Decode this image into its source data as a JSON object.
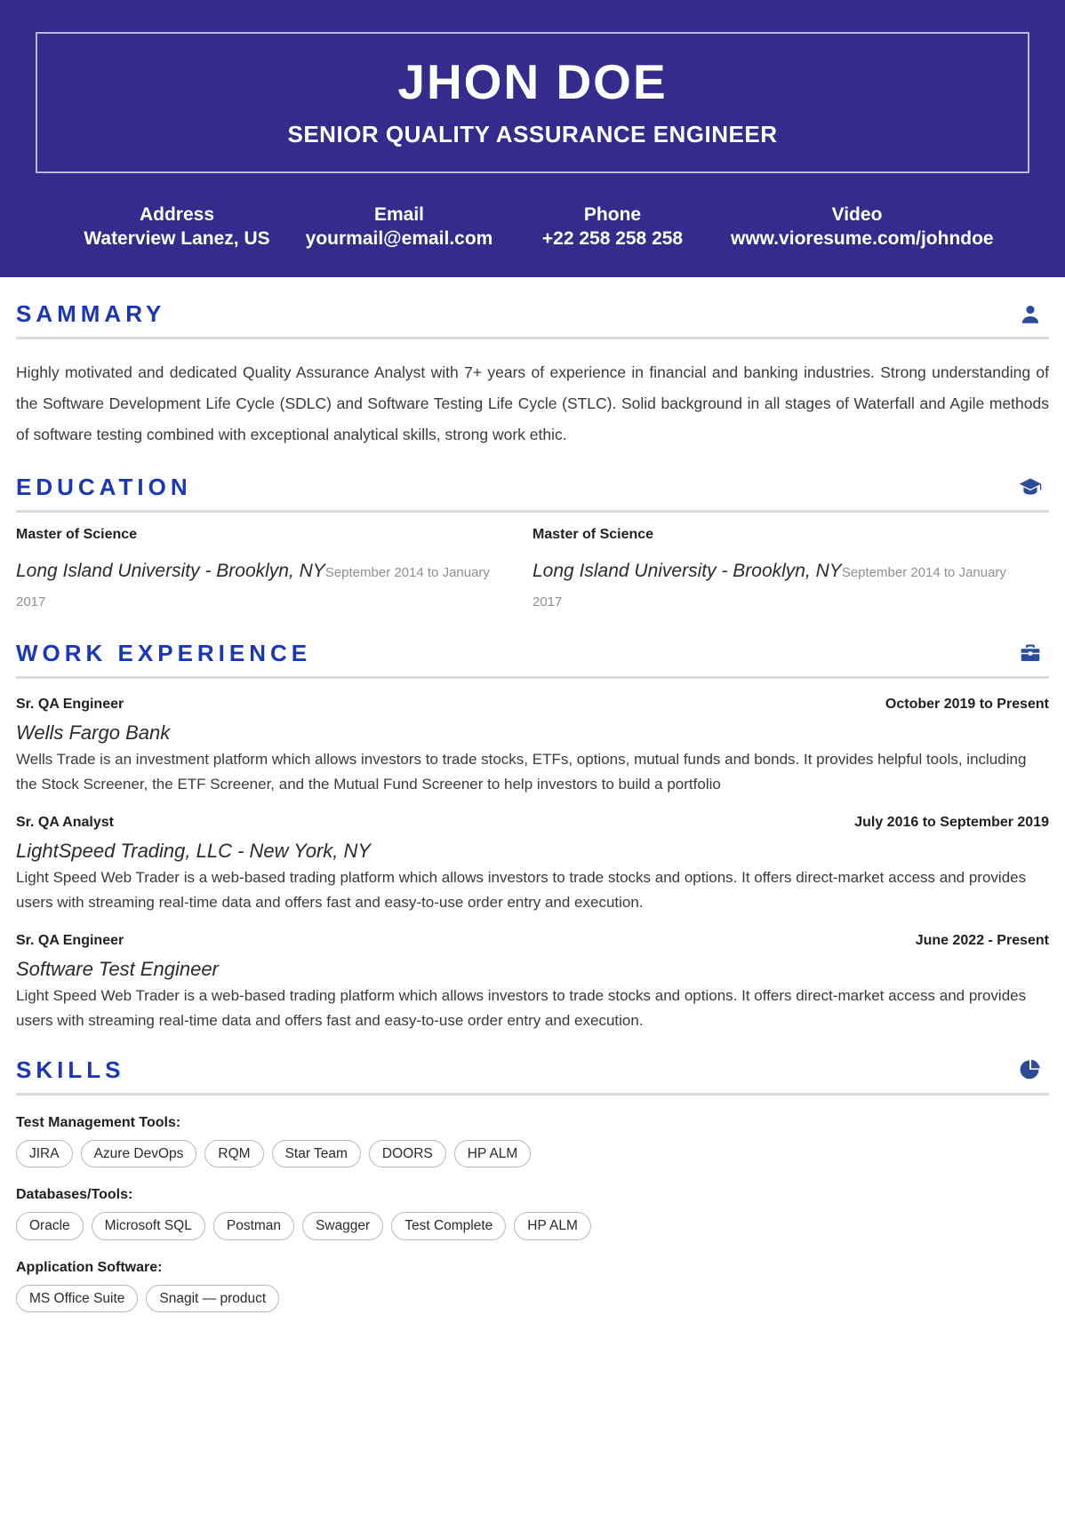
{
  "header": {
    "name": "JHON DOE",
    "title": "SENIOR QUALITY ASSURANCE ENGINEER",
    "accent_color": "#342b8c",
    "contacts": [
      {
        "label": "Address",
        "value": "Waterview Lanez, US"
      },
      {
        "label": "Email",
        "value": "yourmail@email.com"
      },
      {
        "label": "Phone",
        "value": "+22 258 258 258"
      },
      {
        "label": "Video",
        "value": "www.vioresume.com/johndoe"
      }
    ]
  },
  "summary": {
    "title": "SAMMARY",
    "icon": "person-icon",
    "text": "Highly motivated and dedicated Quality Assurance Analyst with 7+ years of experience in financial and banking industries. Strong understanding of the Software Development Life Cycle (SDLC) and Software Testing Life Cycle (STLC). Solid background in all stages of Waterfall and Agile methods of software testing combined with exceptional analytical skills, strong work ethic."
  },
  "education": {
    "title": "EDUCATION",
    "icon": "graduation-cap-icon",
    "entries": [
      {
        "degree": "Master of Science",
        "school": "Long Island University - Brooklyn, NY",
        "dates": "September 2014 to January 2017"
      },
      {
        "degree": "Master of Science",
        "school": "Long Island University - Brooklyn, NY",
        "dates": "September 2014 to January 2017"
      }
    ]
  },
  "work": {
    "title": "WORK EXPERIENCE",
    "icon": "briefcase-icon",
    "jobs": [
      {
        "role": "Sr. QA Engineer",
        "dates": "October 2019 to Present",
        "company": "Wells Fargo Bank",
        "description": "Wells Trade is an investment platform which allows investors to trade stocks, ETFs, options, mutual funds and bonds. It provides helpful tools, including the Stock Screener, the ETF Screener, and the Mutual Fund Screener to help investors to build a portfolio"
      },
      {
        "role": "Sr. QA Analyst",
        "dates": "July 2016 to September 2019",
        "company": "LightSpeed Trading, LLC - New York, NY",
        "description": "Light Speed Web Trader is a web-based trading platform which allows investors to trade stocks and options. It offers direct-market access and provides users with streaming real-time data and offers fast and easy-to-use order entry and execution."
      },
      {
        "role": "Sr. QA Engineer",
        "dates": "June 2022 - Present",
        "company": "Software Test Engineer",
        "description": "Light Speed Web Trader is a web-based trading platform which allows investors to trade stocks and options. It offers direct-market access and provides users with streaming real-time data and offers fast and easy-to-use order entry and execution."
      }
    ]
  },
  "skills": {
    "title": "SKILLS",
    "icon": "pie-chart-icon",
    "groups": [
      {
        "label": "Test Management Tools:",
        "items": [
          "JIRA",
          "Azure DevOps",
          "RQM",
          "Star Team",
          "DOORS",
          "HP ALM"
        ]
      },
      {
        "label": "Databases/Tools:",
        "items": [
          "Oracle",
          "Microsoft SQL",
          "Postman",
          "Swagger",
          "Test Complete",
          "HP ALM"
        ]
      },
      {
        "label": "Application Software:",
        "items": [
          "MS Office Suite",
          "Snagit — product"
        ]
      }
    ]
  }
}
